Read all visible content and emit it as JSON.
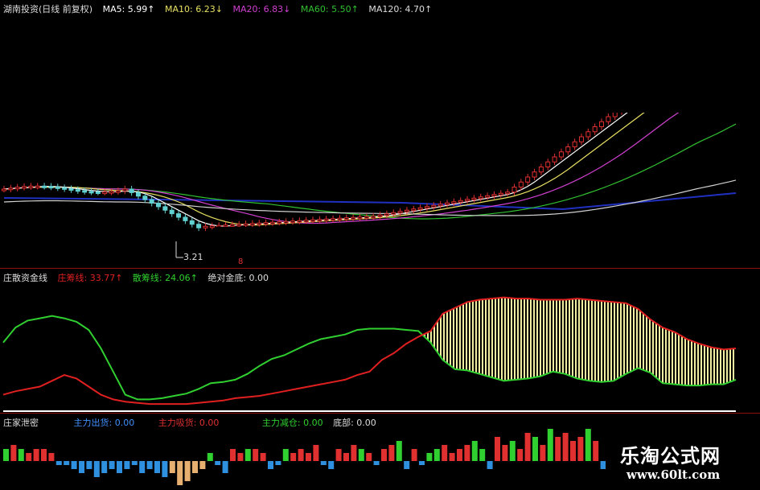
{
  "price_header": {
    "title": "湖南投资(日线 前复权)",
    "ma5": "MA5: 5.99↑",
    "ma10": "MA10: 6.23↓",
    "ma20": "MA20: 6.83↓",
    "ma60": "MA60: 5.50↑",
    "ma120": "MA120: 4.70↑"
  },
  "low_label": "3.21",
  "marker_text": "8",
  "indicator_header": {
    "title": "庄散资金线",
    "zhuang": "庄筹线: 33.77↑",
    "san": "散筹线: 24.06↑",
    "jinding": "绝对金底: 0.00"
  },
  "secret_header": {
    "title": "庄家泄密",
    "chuhuo": "主力出货: 0.00",
    "xihuo": "主力吸货: 0.00",
    "jiancang": "主力减仓: 0.00",
    "dibu": "底部: 0.00"
  },
  "watermark": {
    "title": "乐淘公式网",
    "url": "www.60lt.com"
  },
  "colors": {
    "ma5": "#ffffff",
    "ma10": "#e8e060",
    "ma20": "#d040d0",
    "ma60": "#30c030",
    "ma120": "#d0d0d0",
    "zhuang": "#e02020",
    "san": "#30d030",
    "fill": "#f0f0a0",
    "up": "#e03030",
    "down": "#60d0d0"
  },
  "chart_data": [
    {
      "type": "candlestick",
      "title": "湖南投资(日线 前复权)",
      "series": [
        {
          "name": "MA5",
          "value": 5.99
        },
        {
          "name": "MA10",
          "value": 6.23
        },
        {
          "name": "MA20",
          "value": 6.83
        },
        {
          "name": "MA60",
          "value": 5.5
        },
        {
          "name": "MA120",
          "value": 4.7
        }
      ],
      "annotations": [
        "3.21"
      ]
    },
    {
      "type": "line",
      "title": "庄散资金线",
      "x": [
        0,
        1,
        2,
        3,
        4,
        5,
        6,
        7,
        8,
        9,
        10,
        11,
        12,
        13,
        14,
        15,
        16,
        17,
        18,
        19,
        20,
        21,
        22,
        23,
        24,
        25,
        26,
        27,
        28,
        29,
        30,
        31,
        32,
        33,
        34,
        35,
        36,
        37,
        38,
        39,
        40,
        41,
        42,
        43,
        44,
        45,
        46,
        47,
        48,
        49,
        50,
        51,
        52,
        53,
        54,
        55,
        56,
        57,
        58,
        59,
        60
      ],
      "series": [
        {
          "name": "庄筹线",
          "values": [
            10,
            13,
            15,
            17,
            22,
            27,
            24,
            17,
            10,
            6,
            4,
            3,
            2,
            2,
            2,
            2,
            3,
            4,
            5,
            7,
            8,
            9,
            11,
            13,
            15,
            17,
            19,
            21,
            23,
            27,
            30,
            40,
            46,
            54,
            60,
            65,
            80,
            85,
            90,
            92,
            93,
            94,
            93,
            93,
            92,
            92,
            92,
            93,
            92,
            91,
            90,
            89,
            84,
            75,
            68,
            64,
            58,
            54,
            51,
            49,
            50
          ]
        },
        {
          "name": "散筹线",
          "values": [
            55,
            68,
            74,
            76,
            78,
            76,
            73,
            66,
            50,
            30,
            10,
            6,
            6,
            7,
            9,
            11,
            15,
            20,
            21,
            23,
            28,
            35,
            41,
            44,
            49,
            54,
            58,
            60,
            62,
            66,
            67,
            67,
            67,
            66,
            65,
            55,
            40,
            32,
            31,
            28,
            25,
            22,
            23,
            24,
            26,
            30,
            28,
            24,
            22,
            21,
            22,
            28,
            33,
            29,
            20,
            19,
            18,
            18,
            19,
            19,
            23
          ]
        },
        {
          "name": "绝对金底",
          "values": [
            0
          ]
        }
      ],
      "ylim": [
        0,
        100
      ]
    },
    {
      "type": "bar",
      "title": "庄家泄密",
      "series": [
        {
          "name": "主力出货",
          "value": 0.0
        },
        {
          "name": "主力吸货",
          "value": 0.0
        },
        {
          "name": "主力减仓",
          "value": 0.0
        },
        {
          "name": "底部",
          "value": 0.0
        }
      ],
      "values": [
        3,
        4,
        3,
        2,
        3,
        3,
        2,
        -1,
        -1,
        -2,
        -3,
        -2,
        -4,
        -3,
        -2,
        -3,
        -2,
        -1,
        -3,
        -2,
        -3,
        -4,
        -3,
        -6,
        -5,
        -3,
        -2,
        2,
        -1,
        -3,
        3,
        2,
        3,
        3,
        2,
        -2,
        -1,
        3,
        2,
        3,
        2,
        4,
        -1,
        -2,
        3,
        2,
        4,
        3,
        2,
        -1,
        3,
        4,
        5,
        -2,
        3,
        -1,
        2,
        3,
        4,
        2,
        3,
        4,
        5,
        3,
        -2,
        6,
        4,
        5,
        3,
        7,
        6,
        4,
        8,
        6,
        7,
        5,
        6,
        8,
        5,
        -2
      ]
    }
  ]
}
